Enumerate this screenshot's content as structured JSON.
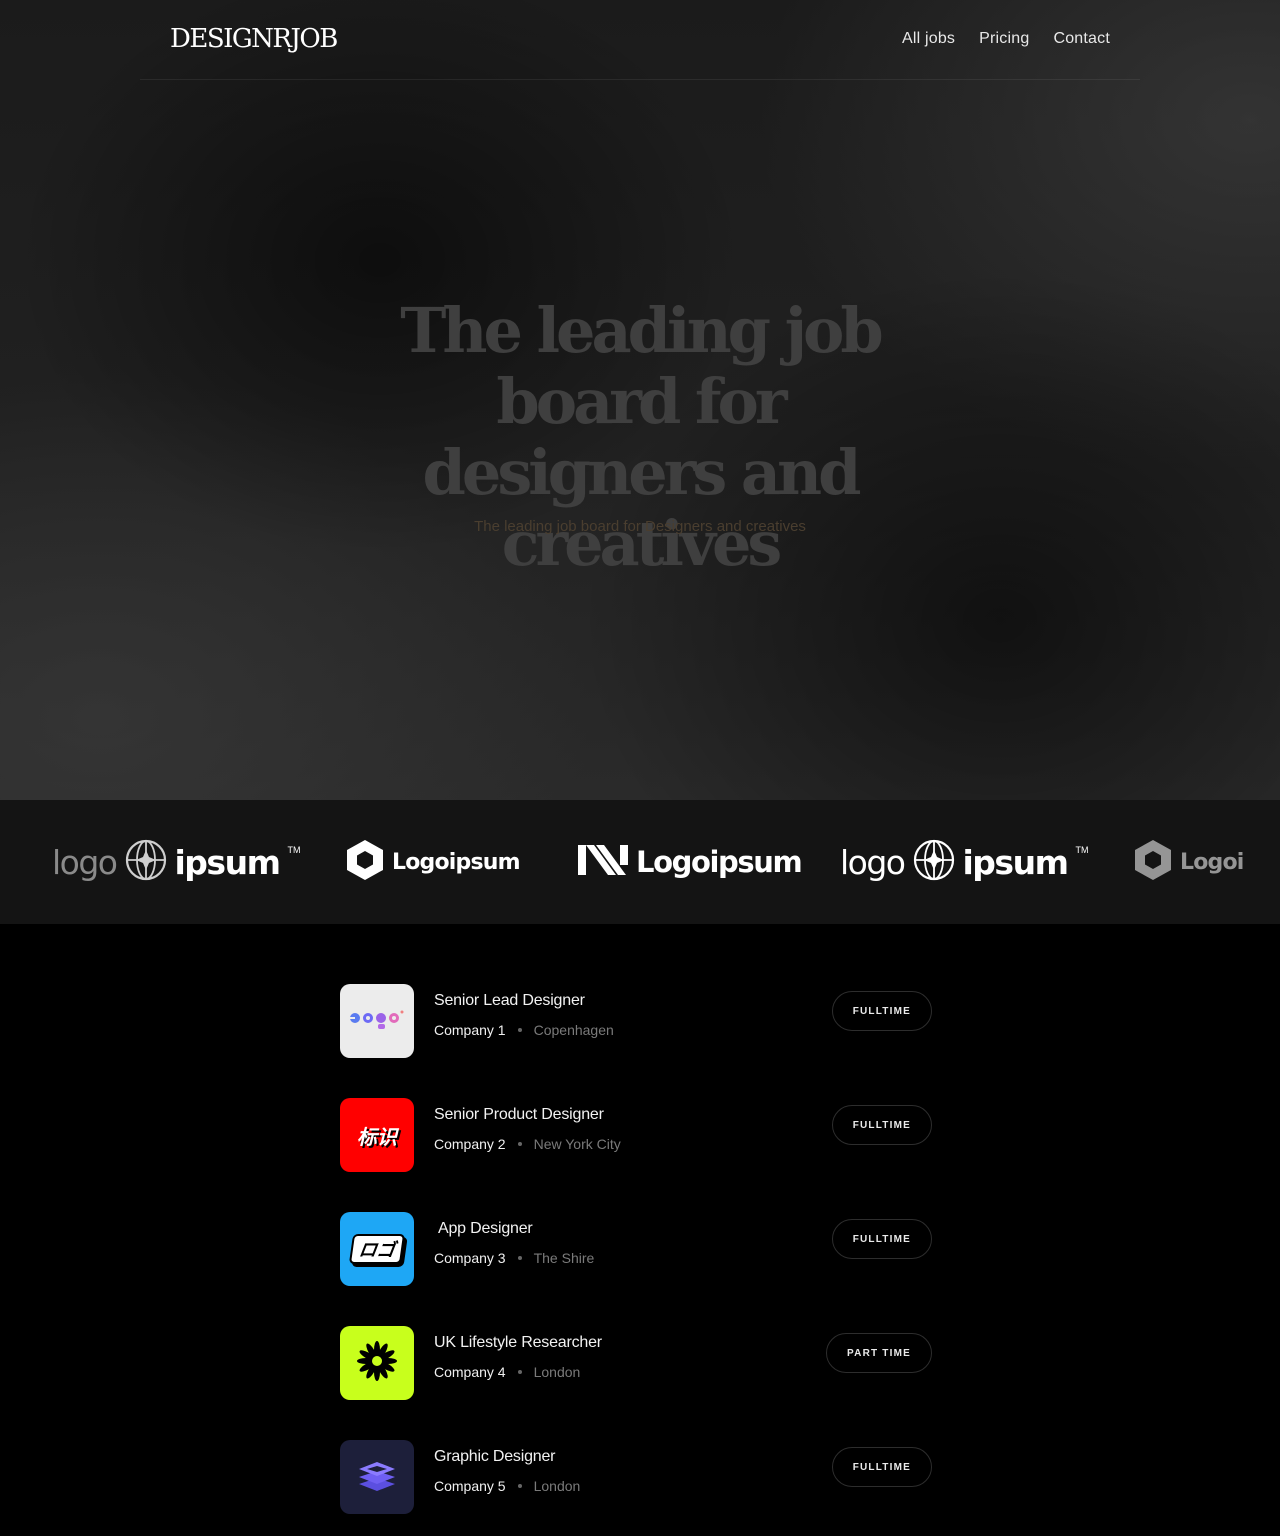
{
  "nav": {
    "brand": "DESIGNRJOB",
    "links": [
      {
        "label": "All jobs"
      },
      {
        "label": "Pricing"
      },
      {
        "label": "Contact"
      }
    ]
  },
  "hero": {
    "title": "The leading job board for designers and creatives",
    "subtitle": "The leading job board for Designers and creatives"
  },
  "logos": [
    {
      "icon": "globe-star-icon",
      "left": "logo",
      "right": "ipsum"
    },
    {
      "icon": "hexagon-icon",
      "text": "Logoipsum"
    },
    {
      "icon": "stripes-n-icon",
      "text": "Logoipsum"
    },
    {
      "icon": "globe-star-icon",
      "left": "logo",
      "right": "ipsum"
    },
    {
      "icon": "hexagon-icon",
      "text": "Logoipsum"
    }
  ],
  "jobs": [
    {
      "title": "Senior Lead Designer",
      "company": "Company 1",
      "location": "Copenhagen",
      "type": "FULLTIME",
      "logo_bg": "#ececec",
      "logo_icon": "colorful-logo-wordmark-icon",
      "logo_text": "logo"
    },
    {
      "title": "Senior Product Designer",
      "company": "Company 2",
      "location": "New York City",
      "type": "FULLTIME",
      "logo_bg": "#ff0000",
      "logo_icon": "kanji-biaoshi-icon",
      "logo_text": "标识"
    },
    {
      "title": "App Designer",
      "company": "Company 3",
      "location": "The Shire",
      "type": "FULLTIME",
      "logo_bg": "#1ea7f5",
      "logo_icon": "katakana-rogo-icon",
      "logo_text": "ロゴ"
    },
    {
      "title": "UK Lifestyle Researcher",
      "company": "Company 4",
      "location": "London",
      "type": "PART TIME",
      "logo_bg": "#c8ff1c",
      "logo_icon": "flower-burst-icon"
    },
    {
      "title": "Graphic Designer",
      "company": "Company 5",
      "location": "London",
      "type": "FULLTIME",
      "logo_bg": "#1d1f3a",
      "logo_icon": "stacked-layers-icon"
    }
  ]
}
